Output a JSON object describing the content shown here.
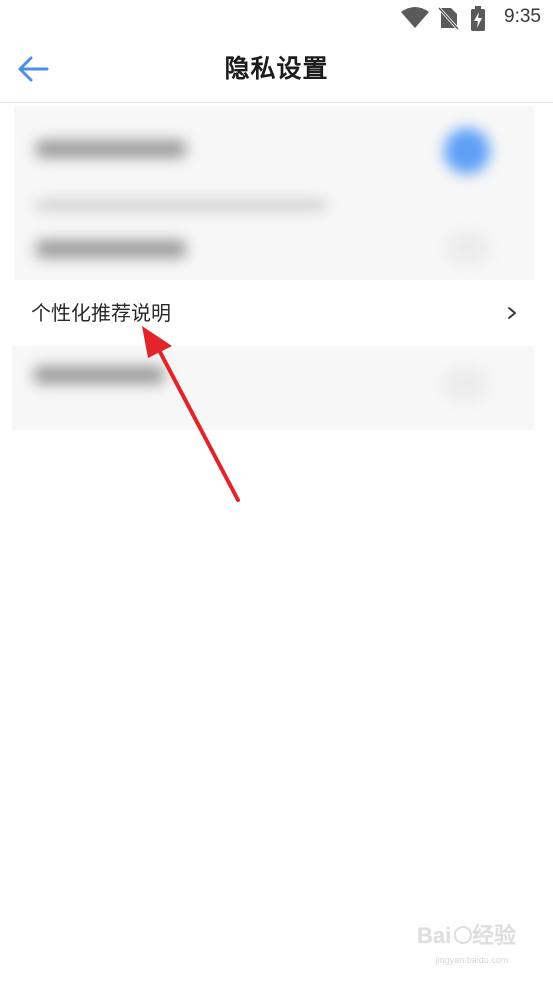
{
  "status_bar": {
    "time": "9:35",
    "icons": [
      "wifi-icon",
      "no-sim-icon",
      "battery-charging-icon"
    ]
  },
  "header": {
    "title": "隐私设置",
    "back_icon": "back-arrow-icon",
    "accent_color": "#4a8fe7"
  },
  "menu": {
    "personalized_recommendation_label": "个性化推荐说明",
    "chevron_icon": "chevron-right-icon"
  },
  "annotation": {
    "arrow_color": "#e3232a"
  },
  "watermark": {
    "logo": "Baidu 经验",
    "url": "jingyan.baidu.com"
  }
}
